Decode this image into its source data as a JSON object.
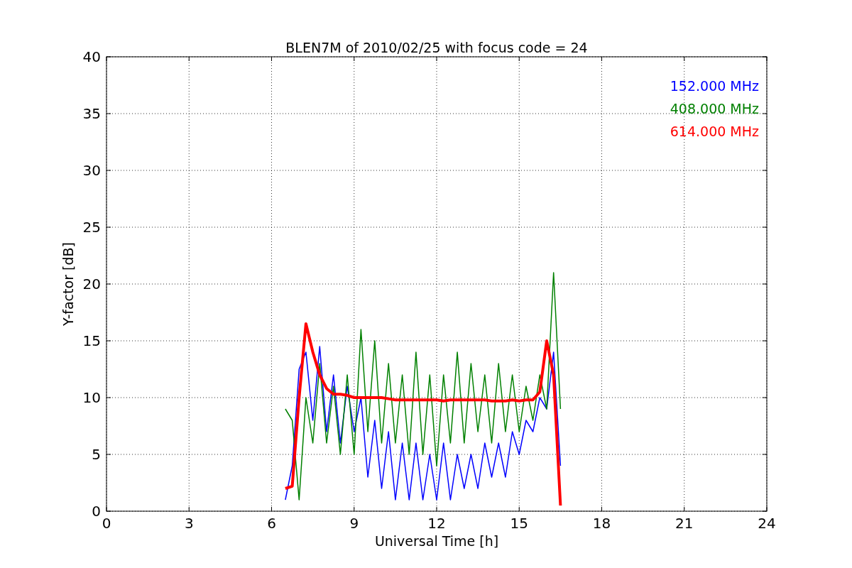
{
  "chart_data": {
    "type": "line",
    "title": "BLEN7M of 2010/02/25 with focus code = 24",
    "xlabel": "Universal Time [h]",
    "ylabel": "Y-factor [dB]",
    "x": [
      6.5,
      6.75,
      7.0,
      7.25,
      7.5,
      7.75,
      8.0,
      8.25,
      8.5,
      8.75,
      9.0,
      9.25,
      9.5,
      9.75,
      10.0,
      10.25,
      10.5,
      10.75,
      11.0,
      11.25,
      11.5,
      11.75,
      12.0,
      12.25,
      12.5,
      12.75,
      13.0,
      13.25,
      13.5,
      13.75,
      14.0,
      14.25,
      14.5,
      14.75,
      15.0,
      15.25,
      15.5,
      15.75,
      16.0,
      16.25,
      16.5
    ],
    "series": [
      {
        "name": "152.000 MHz",
        "color": "#0000ff",
        "values": [
          1,
          4,
          12.5,
          14,
          8,
          14.5,
          7,
          12,
          6,
          11,
          7,
          10,
          3,
          8,
          2,
          7,
          1,
          6,
          1,
          6,
          1,
          5,
          1,
          6,
          1,
          5,
          2,
          5,
          2,
          6,
          3,
          6,
          3,
          7,
          5,
          8,
          7,
          10,
          9,
          14,
          4
        ]
      },
      {
        "name": "408.000 MHz",
        "color": "#008000",
        "values": [
          9,
          8,
          1,
          10,
          6,
          13,
          6,
          11,
          5,
          12,
          5,
          16,
          7,
          15,
          6,
          13,
          6,
          12,
          5,
          14,
          5,
          12,
          4,
          12,
          6,
          14,
          6,
          13,
          7,
          12,
          6,
          13,
          7,
          12,
          7,
          11,
          8,
          12,
          9,
          21,
          9
        ]
      },
      {
        "name": "614.000 MHz",
        "color": "#ff0000",
        "values": [
          2,
          2.2,
          10,
          16.5,
          14,
          12,
          10.8,
          10.3,
          10.3,
          10.2,
          10,
          10,
          10,
          10,
          10,
          9.9,
          9.8,
          9.8,
          9.8,
          9.8,
          9.8,
          9.8,
          9.8,
          9.7,
          9.8,
          9.8,
          9.8,
          9.8,
          9.8,
          9.8,
          9.7,
          9.7,
          9.7,
          9.8,
          9.7,
          9.8,
          9.8,
          10.5,
          15,
          12,
          0.5
        ]
      }
    ],
    "xlim": [
      0,
      24
    ],
    "ylim": [
      0,
      40
    ],
    "xticks": [
      0,
      3,
      6,
      9,
      12,
      15,
      18,
      21,
      24
    ],
    "yticks": [
      0,
      5,
      10,
      15,
      20,
      25,
      30,
      35,
      40
    ],
    "grid": true
  }
}
